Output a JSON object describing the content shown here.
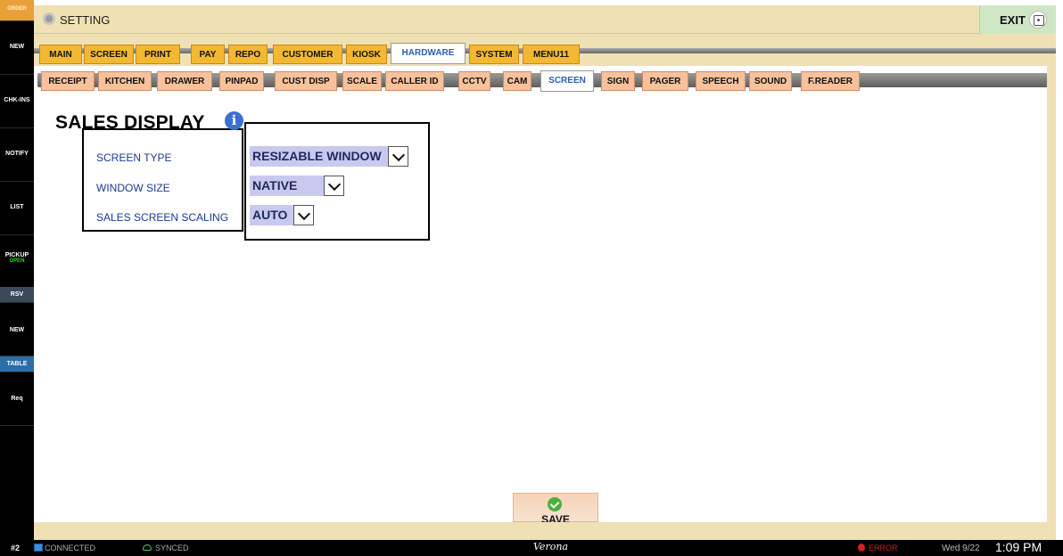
{
  "sidebar": {
    "order": "ORDER",
    "new1": "NEW",
    "chk_ins": "CHK-INS",
    "notify": "NOTIFY",
    "list": "LIST",
    "pickup": "PICKUP",
    "pickup_status": "OPEN",
    "rsv": "RSV",
    "new2": "NEW",
    "table": "TABLE",
    "req": "Req"
  },
  "titlebar": {
    "title": "SETTING",
    "exit_label": "EXIT"
  },
  "main_tabs": [
    "MAIN",
    "SCREEN",
    "PRINT",
    "PAY",
    "REPO",
    "CUSTOMER",
    "KIOSK",
    "HARDWARE",
    "SYSTEM",
    "MENU11"
  ],
  "sub_tabs": [
    "RECEIPT",
    "KITCHEN",
    "DRAWER",
    "PINPAD",
    "CUST DISP",
    "SCALE",
    "CALLER ID",
    "CCTV",
    "CAM",
    "SCREEN",
    "SIGN",
    "PAGER",
    "SPEECH",
    "SOUND",
    "F.READER"
  ],
  "content": {
    "title": "SALES DISPLAY",
    "info_glyph": "i",
    "fields": [
      {
        "label": "SCREEN TYPE",
        "value": "RESIZABLE WINDOW"
      },
      {
        "label": "WINDOW SIZE",
        "value": "NATIVE"
      },
      {
        "label": "SALES SCREEN SCALING",
        "value": "AUTO"
      }
    ],
    "save_label": "SAVE"
  },
  "status": {
    "terminal": "#2",
    "connection": "CONNECTED",
    "sync": "SYNCED",
    "location": "Verona",
    "error": "ERROR",
    "date": "Wed 9/22",
    "time": "1:09 PM"
  },
  "colors": {
    "tab_orange": "#f3b832",
    "subtab_peach": "#f7c19b",
    "active_tab_text": "#2b5fb0",
    "titlebar_tan": "#efe1b4",
    "select_bg": "#c9c9ef",
    "label_blue": "#1a3a8c"
  },
  "icons": [
    "gear-icon",
    "camera-icon",
    "info-icon",
    "chevron-down-icon",
    "check-icon",
    "monitor-icon",
    "cloud-icon",
    "error-icon"
  ]
}
